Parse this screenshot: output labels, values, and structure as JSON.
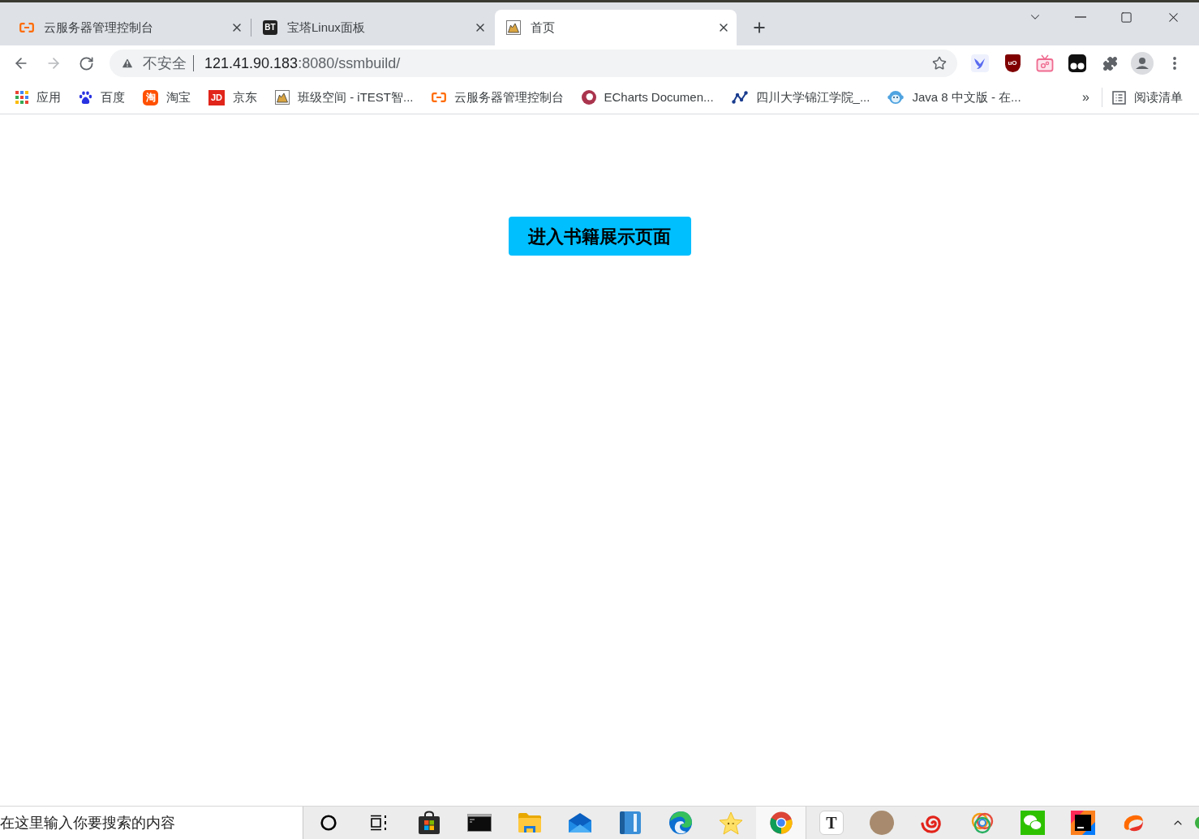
{
  "tabs": [
    {
      "kind": "bracket",
      "title": "云服务器管理控制台",
      "selected": false
    },
    {
      "kind": "badge",
      "icon_text": "BT",
      "title": "宝塔Linux面板",
      "selected": false
    },
    {
      "kind": "picture",
      "title": "首页",
      "selected": true
    }
  ],
  "navigation": {
    "back": {
      "disabled": false
    },
    "forward": {
      "disabled": true
    }
  },
  "address_bar": {
    "security_label": "不安全",
    "url_host": "121.41.90.183",
    "url_path": ":8080/ssmbuild/"
  },
  "extensions": {
    "shield_text": "uO"
  },
  "bookmarks": {
    "items": [
      {
        "kind": "apps",
        "label": "应用"
      },
      {
        "kind": "paw",
        "label": "百度"
      },
      {
        "kind": "tile",
        "icon_text": "淘",
        "label": "淘宝"
      },
      {
        "kind": "square",
        "icon_text": "JD",
        "label": "京东"
      },
      {
        "kind": "picture",
        "label": "班级空间 - iTEST智..."
      },
      {
        "kind": "bracket",
        "label": "云服务器管理控制台"
      },
      {
        "kind": "ring",
        "label": "ECharts Documen..."
      },
      {
        "kind": "graph",
        "label": "四川大学锦江学院_..."
      },
      {
        "kind": "face",
        "label": "Java 8 中文版 - 在..."
      }
    ],
    "overflow": "»",
    "reading_list": "阅读清单"
  },
  "page": {
    "button": "进入书籍展示页面"
  },
  "taskbar": {
    "search": {
      "placeholder": "在这里输入你要搜索的内容"
    },
    "apps": [
      {
        "kind": "ring",
        "selected": false
      },
      {
        "kind": "taskview",
        "selected": false
      },
      {
        "kind": "bag",
        "selected": false
      },
      {
        "kind": "terminal",
        "selected": false
      },
      {
        "kind": "folder",
        "selected": false
      },
      {
        "kind": "envelope",
        "selected": false
      },
      {
        "kind": "book",
        "selected": false
      },
      {
        "kind": "swirl",
        "selected": false
      },
      {
        "kind": "star",
        "selected": false
      },
      {
        "kind": "tricolor",
        "selected": true
      },
      {
        "kind": "letter",
        "icon_text": "T",
        "selected": false
      },
      {
        "kind": "photo",
        "selected": false
      },
      {
        "kind": "spiral",
        "selected": false
      },
      {
        "kind": "rings",
        "selected": false
      },
      {
        "kind": "chat",
        "selected": false
      },
      {
        "kind": "darksquare",
        "selected": false
      },
      {
        "kind": "flame",
        "selected": false
      }
    ]
  }
}
